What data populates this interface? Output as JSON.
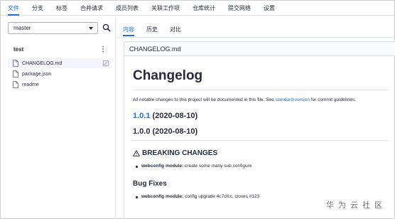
{
  "nav": {
    "items": [
      "文件",
      "分支",
      "标签",
      "合并请求",
      "成员列表",
      "关联工作项",
      "仓库统计",
      "提交网络",
      "设置"
    ],
    "active_index": 0
  },
  "sidebar": {
    "branch_value": "master",
    "repo_name": "test",
    "files": [
      {
        "name": "CHANGELOG.md",
        "selected": true
      },
      {
        "name": "package.json",
        "selected": false
      },
      {
        "name": "readme",
        "selected": false
      }
    ]
  },
  "tabs": [
    "内容",
    "历史",
    "对比"
  ],
  "viewer": {
    "file_title": "CHANGELOG.md",
    "h1": "Changelog",
    "intro_prefix": "All notable changes to this project will be documented in this file. See ",
    "intro_link": "standard-version",
    "intro_suffix": " for commit guidelines.",
    "v101_link": "1.0.1",
    "v101_date": " (2020-08-10)",
    "v100": "1.0.0 (2020-08-10)",
    "breaking_heading": "BREAKING CHANGES",
    "breaking_item_bold": "webconfig module:",
    "breaking_item_text": " create some many sub configure",
    "bug_heading": "Bug Fixes",
    "bug_item_bold": "webconfig module:",
    "bug_item_text": " config upgrade 4c7cfcc, closes #123"
  },
  "watermark": "华为云社区",
  "colors": {
    "accent": "#1e6fd9",
    "text": "#252b3a",
    "border": "#dfe1e6"
  }
}
